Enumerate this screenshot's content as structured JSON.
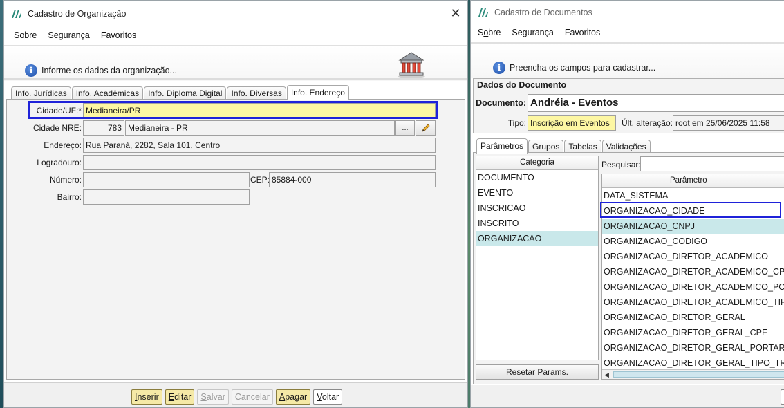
{
  "left_window": {
    "title": "Cadastro de Organização",
    "menu": [
      {
        "pre": "S",
        "key": "o",
        "post": "bre"
      },
      {
        "pre": "Segurança",
        "key": "",
        "post": ""
      },
      {
        "pre": "Favoritos",
        "key": "",
        "post": ""
      }
    ],
    "banner_text": "Informe os dados da organização...",
    "tabs": [
      "Info. Jurídicas",
      "Info. Acadêmicas",
      "Info. Diploma Digital",
      "Info. Diversas",
      "Info. Endereço"
    ],
    "active_tab": "Info. Endereço",
    "form": {
      "cidade_uf_label": "Cidade/UF:*",
      "cidade_uf_value": "Medianeira/PR",
      "cidade_nre_label": "Cidade NRE:",
      "cidade_nre_code": "783",
      "cidade_nre_name": "Medianeira - PR",
      "lookup_button": "...",
      "endereco_label": "Endereço:",
      "endereco_value": "Rua Paraná, 2282, Sala 101, Centro",
      "logradouro_label": "Logradouro:",
      "logradouro_value": "",
      "numero_label": "Número:",
      "numero_value": "",
      "cep_label": "CEP:",
      "cep_value": "85884-000",
      "bairro_label": "Bairro:",
      "bairro_value": ""
    },
    "footer_buttons": [
      {
        "key": "I",
        "rest": "nserir",
        "style": "yellow"
      },
      {
        "key": "E",
        "rest": "ditar",
        "style": "yellow"
      },
      {
        "key": "S",
        "rest": "alvar",
        "style": "disabled"
      },
      {
        "key": "",
        "rest": "Cancelar",
        "style": "disabled"
      },
      {
        "key": "A",
        "rest": "pagar",
        "style": "yellow"
      },
      {
        "key": "V",
        "rest": "oltar",
        "style": "plain"
      }
    ]
  },
  "right_window": {
    "title": "Cadastro de Documentos",
    "menu": [
      {
        "pre": "S",
        "key": "o",
        "post": "bre"
      },
      {
        "pre": "Segurança",
        "key": "",
        "post": ""
      },
      {
        "pre": "Favoritos",
        "key": "",
        "post": ""
      }
    ],
    "banner_text": "Preencha os campos para cadastrar...",
    "section_title": "Dados do Documento",
    "documento_label": "Documento:",
    "documento_value": "Andréia - Eventos",
    "tipo_label": "Tipo:",
    "tipo_value": "Inscrição em Eventos",
    "ult_alteracao_label": "Últ. alteração:",
    "ult_alteracao_value": "root em 25/06/2025 11:58",
    "tabs": [
      "Parâmetros",
      "Grupos",
      "Tabelas",
      "Validações"
    ],
    "active_tab": "Parâmetros",
    "categoria_header": "Categoria",
    "categories": [
      "DOCUMENTO",
      "EVENTO",
      "INSCRICAO",
      "INSCRITO",
      "ORGANIZACAO"
    ],
    "selected_category": "ORGANIZACAO",
    "pesquisar_label": "Pesquisar:",
    "pesquisar_value": "",
    "parametro_header": "Parâmetro",
    "parameters": [
      "DATA_SISTEMA",
      "ORGANIZACAO_CIDADE",
      "ORGANIZACAO_CNPJ",
      "ORGANIZACAO_CODIGO",
      "ORGANIZACAO_DIRETOR_ACADEMICO",
      "ORGANIZACAO_DIRETOR_ACADEMICO_CPF",
      "ORGANIZACAO_DIRETOR_ACADEMICO_PORT...",
      "ORGANIZACAO_DIRETOR_ACADEMICO_TIPO_...",
      "ORGANIZACAO_DIRETOR_GERAL",
      "ORGANIZACAO_DIRETOR_GERAL_CPF",
      "ORGANIZACAO_DIRETOR_GERAL_PORTARIA",
      "ORGANIZACAO_DIRETOR_GERAL_TIPO_TRATA..."
    ],
    "selected_parameter": "ORGANIZACAO_CNPJ",
    "highlighted_parameter": "ORGANIZACAO_CIDADE",
    "reset_button": "Resetar Params."
  },
  "colors": {
    "highlight_border": "#1f22d9",
    "selection": "#c9e8ea",
    "required_yellow": "#fdf7a3",
    "button_yellow": "#f5e9a6"
  }
}
